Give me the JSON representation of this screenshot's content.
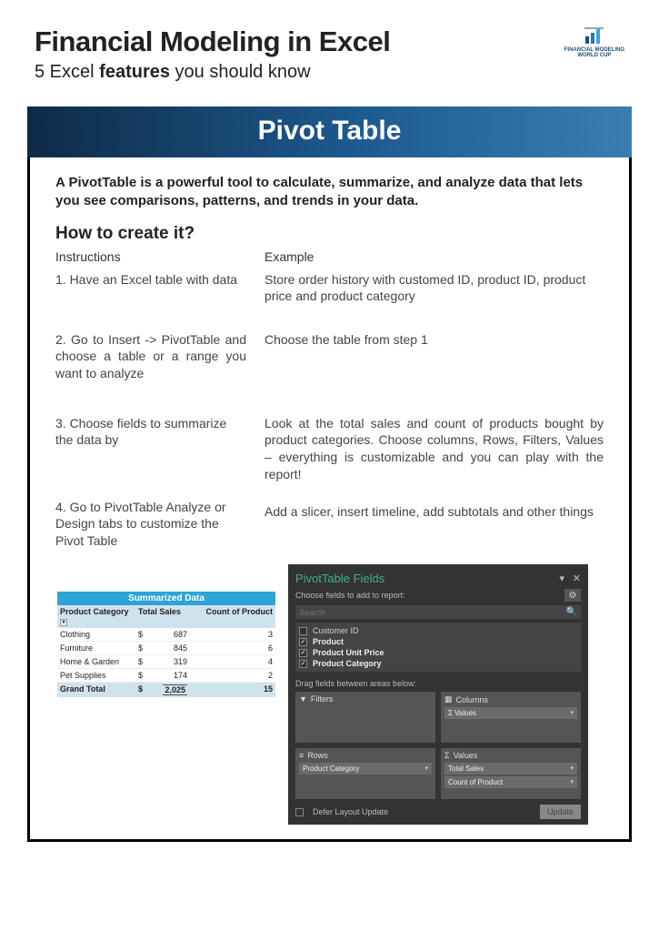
{
  "header": {
    "title": "Financial Modeling in Excel",
    "subtitle_pre": "5 Excel ",
    "subtitle_bold": "features",
    "subtitle_post": " you should know",
    "logo_line1": "FINANCIAL MODELING",
    "logo_line2": "WORLD CUP"
  },
  "main": {
    "banner": "Pivot Table",
    "intro": "A PivotTable is a powerful tool to calculate, summarize, and analyze data that lets you see comparisons, patterns, and trends in your data.",
    "howto": "How to create it?",
    "col_headers": {
      "left": "Instructions",
      "right": "Example"
    },
    "steps": [
      {
        "instr": "1. Have an Excel table with data",
        "ex": "Store order history with customed ID, product ID, product price and product category"
      },
      {
        "instr": "2. Go to Insert -> PivotTable and choose a table or a range you want to analyze",
        "ex": "Choose the table from step 1"
      },
      {
        "instr": "3. Choose fields to summarize the data by",
        "ex": "Look at the total sales and count of products bought by product categories. Choose columns, Rows, Filters, Values – everything is customizable and you can play with the report!"
      },
      {
        "instr": "4. Go to PivotTable Analyze or Design tabs to customize the Pivot Table",
        "ex": "Add a slicer, insert timeline, add subtotals and other things"
      }
    ]
  },
  "summary_table": {
    "title": "Summarized Data",
    "headers": {
      "cat": "Product Category",
      "sales": "Total Sales",
      "count": "Count of Product"
    },
    "rows": [
      {
        "cat": "Clothing",
        "cur": "$",
        "sales": "687",
        "count": "3"
      },
      {
        "cat": "Furniture",
        "cur": "$",
        "sales": "845",
        "count": "6"
      },
      {
        "cat": "Home & Garden",
        "cur": "$",
        "sales": "319",
        "count": "4"
      },
      {
        "cat": "Pet Supplies",
        "cur": "$",
        "sales": "174",
        "count": "2"
      }
    ],
    "grand": {
      "label": "Grand Total",
      "cur": "$",
      "sales": "2,025",
      "count": "15"
    }
  },
  "pivot_panel": {
    "title": "PivotTable Fields",
    "subtitle": "Choose fields to add to report:",
    "search_placeholder": "Search",
    "fields": [
      {
        "label": "Customer ID",
        "checked": false
      },
      {
        "label": "Product",
        "checked": true
      },
      {
        "label": "Product Unit Price",
        "checked": true
      },
      {
        "label": "Product Category",
        "checked": true
      }
    ],
    "drag_label": "Drag fields between areas below:",
    "areas": {
      "filters": {
        "label": "Filters",
        "items": []
      },
      "columns": {
        "label": "Columns",
        "items": [
          "Σ Values"
        ]
      },
      "rows": {
        "label": "Rows",
        "items": [
          "Product Category"
        ]
      },
      "values": {
        "label": "Values",
        "items": [
          "Total Sales",
          "Count of Product"
        ]
      }
    },
    "defer": "Defer Layout Update",
    "update": "Update"
  }
}
